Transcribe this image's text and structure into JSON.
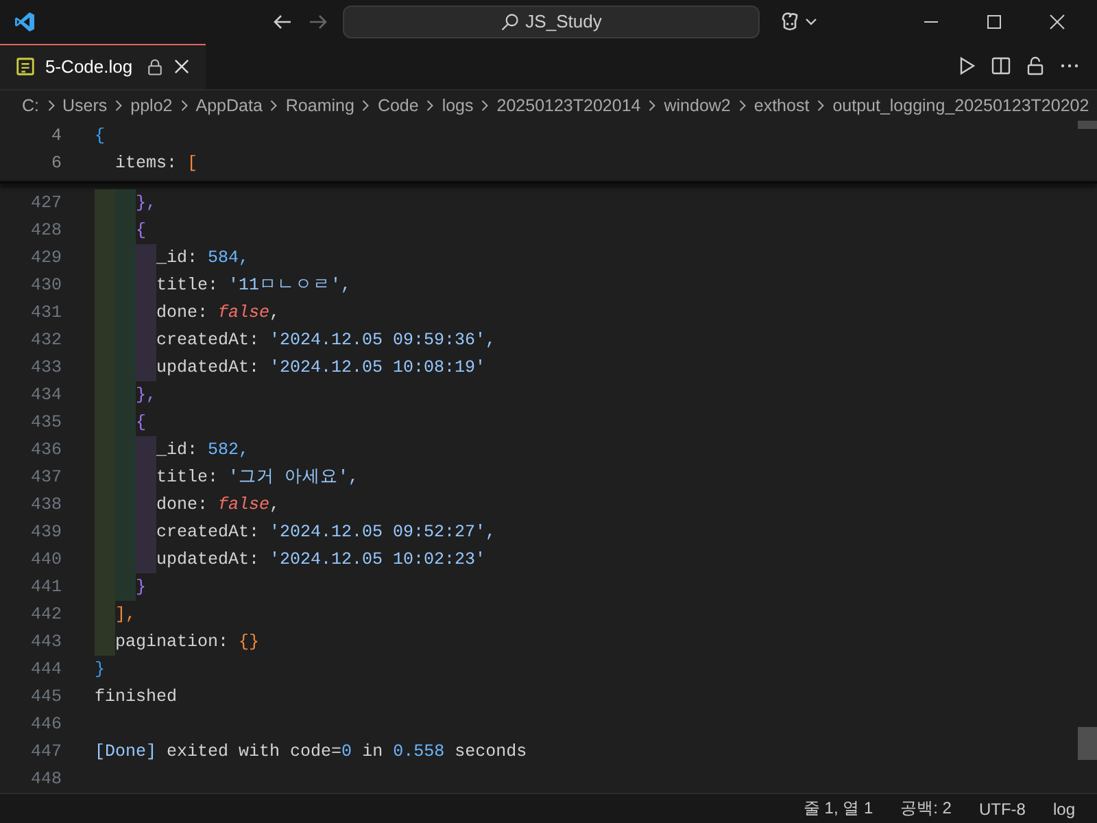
{
  "window": {
    "search": "JS_Study",
    "forward_disabled": true
  },
  "tabs": [
    {
      "label": "5-Code.log",
      "selected": true,
      "locked": true
    }
  ],
  "breadcrumbs": [
    "C:",
    "Users",
    "pplo2",
    "AppData",
    "Roaming",
    "Code",
    "logs",
    "20250123T202014",
    "window2",
    "exthost",
    "output_logging_20250123T20202"
  ],
  "code": [
    {
      "number": "4",
      "sticky": true,
      "tokens": [
        {
          "kind": "bracket",
          "text": "{",
          "color": "#3b9cf0"
        }
      ],
      "children": [
        {
          "number": "6",
          "sticky": true,
          "tokens": [
            {
              "kind": "key",
              "text": "items"
            },
            {
              "kind": "punct",
              "text": ":"
            },
            {
              "kind": "bracket",
              "text": "[",
              "color": "#f0883e"
            }
          ],
          "children": [
            {
              "number": "427",
              "sticky": false,
              "tokens": [
                {
                  "kind": "bracket",
                  "text": "},",
                  "color": "#a074f0"
                }
              ]
            },
            {
              "number": "428",
              "sticky": false,
              "tokens": [
                {
                  "kind": "bracket",
                  "text": "{",
                  "color": "#a074f0"
                }
              ],
              "children": [
                {
                  "number": "429",
                  "sticky": false,
                  "tokens": [
                    {
                      "kind": "key",
                      "text": "_id:"
                    },
                    {
                      "kind": "num",
                      "text": "584,"
                    }
                  ]
                },
                {
                  "number": "430",
                  "sticky": false,
                  "tokens": [
                    {
                      "kind": "key",
                      "text": "title:"
                    },
                    {
                      "kind": "str",
                      "text": "'11ㅁㄴㅇㄹ',"
                    }
                  ]
                },
                {
                  "number": "431",
                  "sticky": false,
                  "tokens": [
                    {
                      "kind": "key",
                      "text": "done:"
                    },
                    {
                      "kind": "kw",
                      "text": "false"
                    },
                    {
                      "kind": "punct",
                      "text": ","
                    }
                  ]
                },
                {
                  "number": "432",
                  "sticky": false,
                  "tokens": [
                    {
                      "kind": "key",
                      "text": "createdAt:"
                    },
                    {
                      "kind": "str",
                      "text": "'2024.12.05 09:59:36',"
                    }
                  ]
                },
                {
                  "number": "433",
                  "sticky": false,
                  "tokens": [
                    {
                      "kind": "key",
                      "text": "updatedAt:"
                    },
                    {
                      "kind": "str",
                      "text": "'2024.12.05 10:08:19'"
                    }
                  ]
                }
              ]
            },
            {
              "number": "434",
              "sticky": false,
              "tokens": [
                {
                  "kind": "bracket",
                  "text": "},",
                  "color": "#a074f0"
                }
              ]
            },
            {
              "number": "435",
              "sticky": false,
              "tokens": [
                {
                  "kind": "bracket",
                  "text": "{",
                  "color": "#a074f0"
                }
              ],
              "children": [
                {
                  "number": "436",
                  "sticky": false,
                  "tokens": [
                    {
                      "kind": "key",
                      "text": "_id:"
                    },
                    {
                      "kind": "num",
                      "text": "582,"
                    }
                  ]
                },
                {
                  "number": "437",
                  "sticky": false,
                  "tokens": [
                    {
                      "kind": "key",
                      "text": "title:"
                    },
                    {
                      "kind": "str",
                      "text": "'그거 아세요',"
                    }
                  ]
                },
                {
                  "number": "438",
                  "sticky": false,
                  "tokens": [
                    {
                      "kind": "key",
                      "text": "done:"
                    },
                    {
                      "kind": "kw",
                      "text": "false"
                    },
                    {
                      "kind": "punct",
                      "text": ","
                    }
                  ]
                },
                {
                  "number": "439",
                  "sticky": false,
                  "tokens": [
                    {
                      "kind": "key",
                      "text": "createdAt:"
                    },
                    {
                      "kind": "str",
                      "text": "'2024.12.05 09:52:27',"
                    }
                  ]
                },
                {
                  "number": "440",
                  "sticky": false,
                  "tokens": [
                    {
                      "kind": "key",
                      "text": "updatedAt:"
                    },
                    {
                      "kind": "str",
                      "text": "'2024.12.05 10:02:23'"
                    }
                  ]
                }
              ]
            },
            {
              "number": "441",
              "sticky": false,
              "tokens": [
                {
                  "kind": "bracket",
                  "text": "}",
                  "color": "#a074f0"
                }
              ]
            }
          ]
        },
        {
          "number": "442",
          "sticky": false,
          "tokens": [
            {
              "kind": "bracket",
              "text": "],",
              "color": "#f0883e"
            }
          ]
        },
        {
          "number": "443",
          "sticky": false,
          "tokens": [
            {
              "kind": "key",
              "text": "pagination:"
            },
            {
              "kind": "bracket",
              "text": "{}",
              "color": "#f0883e"
            }
          ]
        }
      ]
    },
    {
      "number": "444",
      "sticky": false,
      "tokens": [
        {
          "kind": "bracket",
          "text": "}",
          "color": "#3b9cf0"
        }
      ]
    },
    {
      "number": "445",
      "sticky": false,
      "tokens": [
        {
          "kind": "plain",
          "text": "finished"
        }
      ]
    },
    {
      "number": "446",
      "sticky": false
    },
    {
      "number": "447",
      "sticky": false,
      "tokens": [
        {
          "kind": "info",
          "text": "[Done]"
        },
        {
          "kind": "plain",
          "text": "exited with code="
        },
        {
          "kind": "num",
          "text": "0"
        },
        {
          "kind": "plain",
          "text": "in"
        },
        {
          "kind": "num",
          "text": "0.558"
        },
        {
          "kind": "plain",
          "text": "seconds"
        }
      ]
    },
    {
      "number": "448",
      "sticky": false
    }
  ],
  "status_bar": [
    "줄 1, 열 1",
    "공백: 2",
    "UTF-8",
    "log"
  ]
}
